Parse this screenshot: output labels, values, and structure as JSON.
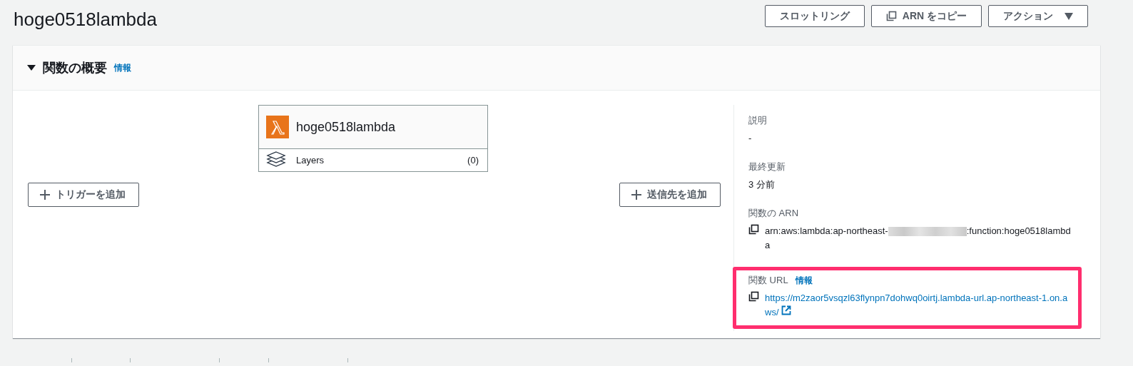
{
  "page_title": "hoge0518lambda",
  "header_buttons": [
    {
      "kind": "plain",
      "label": "スロットリング"
    },
    {
      "kind": "copy",
      "label": "ARN をコピー"
    },
    {
      "kind": "dropdown",
      "label": "アクション"
    }
  ],
  "overview": {
    "title": "関数の概要",
    "info_link": "情報",
    "expanded": true,
    "function_card": {
      "name": "hoge0518lambda",
      "layers_label": "Layers",
      "layers_count": "(0)"
    },
    "add_trigger": "トリガーを追加",
    "add_destination": "送信先を追加",
    "details": [
      {
        "kind": "text",
        "label": "説明",
        "value": "-"
      },
      {
        "kind": "text",
        "label": "最終更新",
        "value": "3 分前"
      },
      {
        "kind": "arn",
        "label": "関数の ARN",
        "value_start": "arn:aws:lambda:ap-northeast-",
        "redacted": true,
        "value_end": ":function:hoge0518lambda"
      },
      {
        "kind": "url",
        "label": "関数 URL",
        "info_link": "情報",
        "value": "https://m2zaor5vsqzl63flynpn7dohwq0oirtj.lambda-url.ap-northeast-1.on.aws/",
        "highlighted": true
      }
    ]
  }
}
